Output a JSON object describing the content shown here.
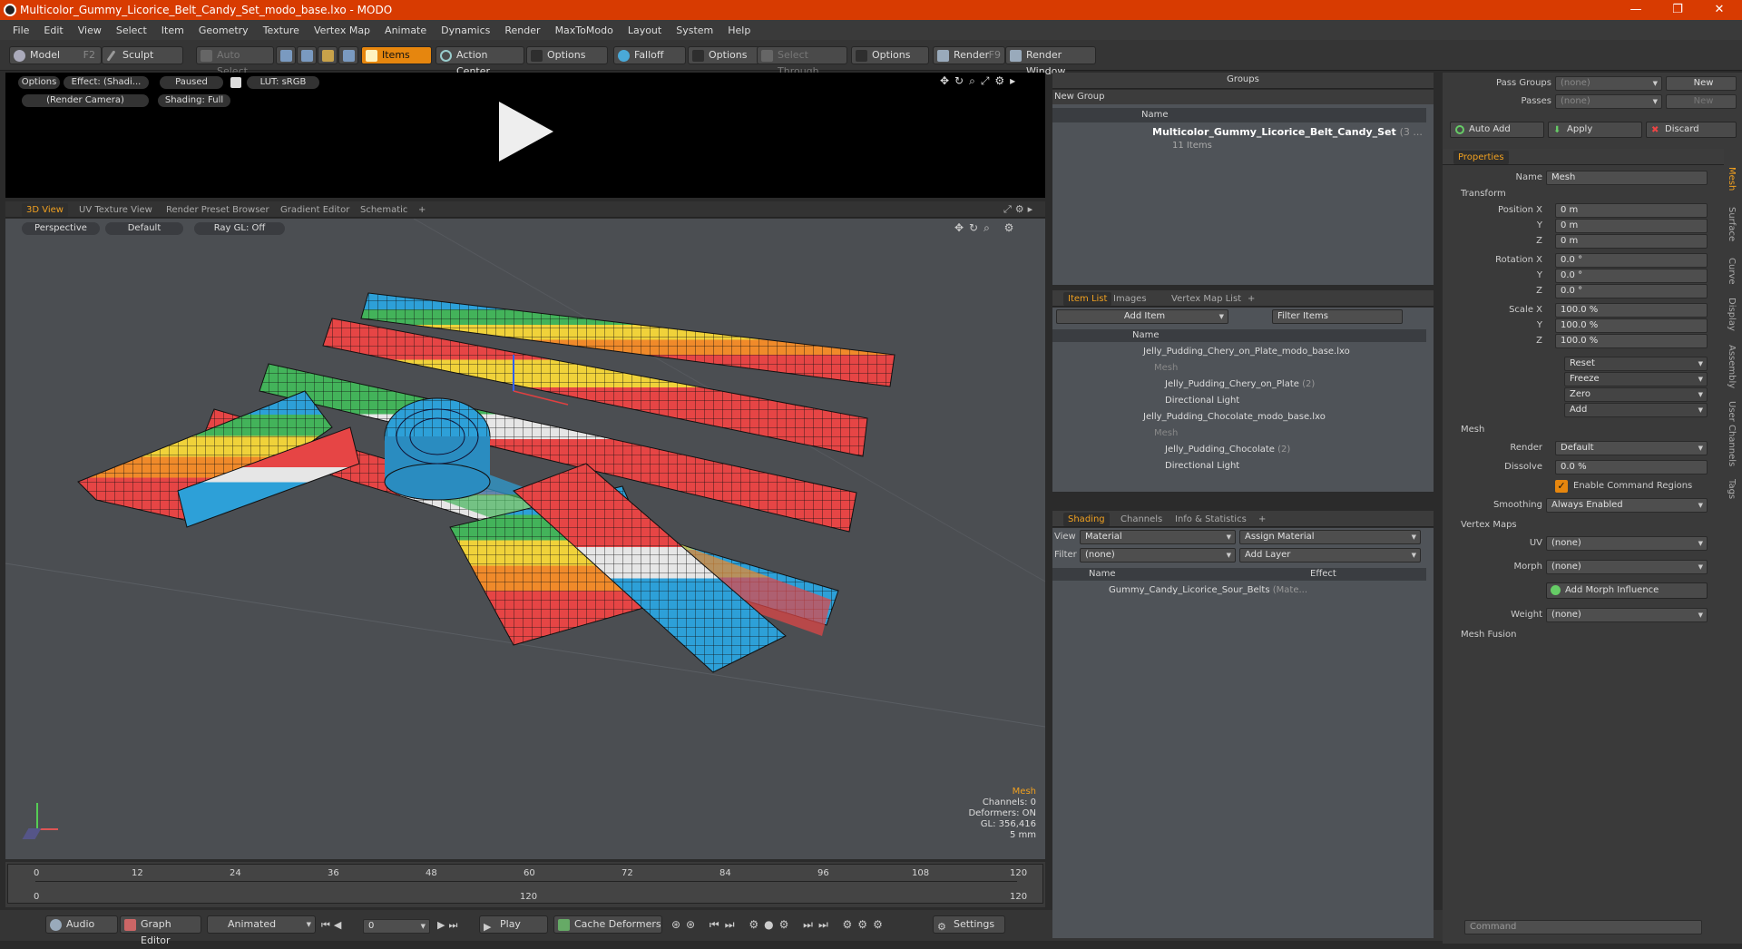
{
  "window": {
    "title": "Multicolor_Gummy_Licorice_Belt_Candy_Set_modo_base.lxo - MODO",
    "controls": [
      "—",
      "❐",
      "✕"
    ]
  },
  "menu": [
    "File",
    "Edit",
    "View",
    "Select",
    "Item",
    "Geometry",
    "Texture",
    "Vertex Map",
    "Animate",
    "Dynamics",
    "Render",
    "MaxToModo",
    "Layout",
    "System",
    "Help"
  ],
  "toolbar": {
    "model": "Model",
    "model_key": "F2",
    "sculpt": "Sculpt",
    "auto_select": "Auto Select",
    "items": "Items",
    "action_center": "Action Center",
    "options1": "Options",
    "falloff": "Falloff",
    "options2": "Options",
    "select_through": "Select Through",
    "options3": "Options",
    "render": "Render",
    "render_key": "F9",
    "render_window": "Render Window"
  },
  "preview": {
    "options": "Options",
    "effect": "Effect: (Shadi...",
    "paused": "Paused",
    "lut": "LUT: sRGB",
    "camera": "(Render Camera)",
    "shading": "Shading: Full"
  },
  "viewport_tabs": [
    "3D View",
    "UV Texture View",
    "Render Preset Browser",
    "Gradient Editor",
    "Schematic",
    "+"
  ],
  "viewport": {
    "perspective": "Perspective",
    "default": "Default",
    "raygl": "Ray GL: Off",
    "info_title": "Mesh",
    "channels": "Channels: 0",
    "deformers": "Deformers: ON",
    "gl": "GL: 356,416",
    "unit": "5 mm"
  },
  "timeline": {
    "ticks": [
      "0",
      "12",
      "24",
      "36",
      "48",
      "60",
      "72",
      "84",
      "96",
      "108",
      "120"
    ],
    "lower_ticks": [
      "0",
      "120",
      "120"
    ]
  },
  "bottombar": {
    "audio": "Audio",
    "graph_editor": "Graph Editor",
    "animated": "Animated",
    "frame": "0",
    "play": "Play",
    "cache_deformers": "Cache Deformers",
    "settings": "Settings"
  },
  "groups": {
    "title": "Groups",
    "new_group": "New Group",
    "col_name": "Name",
    "item_name": "Multicolor_Gummy_Licorice_Belt_Candy_Set",
    "item_suffix": "(3 ...",
    "item_count": "11 Items"
  },
  "itemlist": {
    "tabs": [
      "Item List",
      "Images",
      "Vertex Map List",
      "+"
    ],
    "add_item": "Add Item",
    "filter": "Filter Items",
    "col_name": "Name",
    "rows": [
      {
        "label": "Jelly_Pudding_Chery_on_Plate_modo_base.lxo",
        "indent": 0,
        "dim": false
      },
      {
        "label": "Mesh",
        "indent": 1,
        "dim": true
      },
      {
        "label": "Jelly_Pudding_Chery_on_Plate",
        "suffix": "(2)",
        "indent": 1,
        "dim": false
      },
      {
        "label": "Directional Light",
        "indent": 1,
        "dim": false
      },
      {
        "label": "Jelly_Pudding_Chocolate_modo_base.lxo",
        "indent": 0,
        "dim": false
      },
      {
        "label": "Mesh",
        "indent": 1,
        "dim": true
      },
      {
        "label": "Jelly_Pudding_Chocolate",
        "suffix": "(2)",
        "indent": 1,
        "dim": false
      },
      {
        "label": "Directional Light",
        "indent": 1,
        "dim": false
      }
    ]
  },
  "shading": {
    "tabs": [
      "Shading",
      "Channels",
      "Info & Statistics",
      "+"
    ],
    "view_label": "View",
    "view_value": "Material",
    "assign_material": "Assign Material",
    "filter_label": "Filter",
    "filter_value": "(none)",
    "add_layer": "Add Layer",
    "col_name": "Name",
    "col_effect": "Effect",
    "item": "Gummy_Candy_Licorice_Sour_Belts",
    "item_suffix": "(Mate..."
  },
  "passes": {
    "pass_groups": "Pass Groups",
    "passes": "Passes",
    "none": "(none)",
    "new": "New",
    "auto_add": "Auto Add",
    "apply": "Apply",
    "discard": "Discard"
  },
  "properties": {
    "tab": "Properties",
    "name_label": "Name",
    "name_value": "Mesh",
    "transform": "Transform",
    "position_label": "Position X",
    "position": [
      "0 m",
      "0 m",
      "0 m"
    ],
    "rotation_label": "Rotation X",
    "rotation": [
      "0.0 °",
      "0.0 °",
      "0.0 °"
    ],
    "scale_label": "Scale X",
    "scale": [
      "100.0 %",
      "100.0 %",
      "100.0 %"
    ],
    "axis_y": "Y",
    "axis_z": "Z",
    "reset": "Reset",
    "freeze": "Freeze",
    "zero": "Zero",
    "add": "Add",
    "mesh": "Mesh",
    "render_label": "Render",
    "render_value": "Default",
    "dissolve_label": "Dissolve",
    "dissolve_value": "0.0 %",
    "enable_cmd": "Enable Command Regions",
    "smoothing_label": "Smoothing",
    "smoothing_value": "Always Enabled",
    "vertex_maps": "Vertex Maps",
    "uv_label": "UV",
    "uv_value": "(none)",
    "morph_label": "Morph",
    "morph_value": "(none)",
    "add_morph": "Add Morph Influence",
    "weight_label": "Weight",
    "weight_value": "(none)",
    "mesh_fusion": "Mesh Fusion",
    "side_tabs": [
      "Mesh",
      "Surface",
      "Curve",
      "Display",
      "Assembly",
      "User Channels",
      "Tags"
    ]
  },
  "command": {
    "placeholder": "Command"
  },
  "colors": {
    "accent": "#e6860e",
    "title": "#d83b01",
    "viewport": "#4b4e52"
  }
}
